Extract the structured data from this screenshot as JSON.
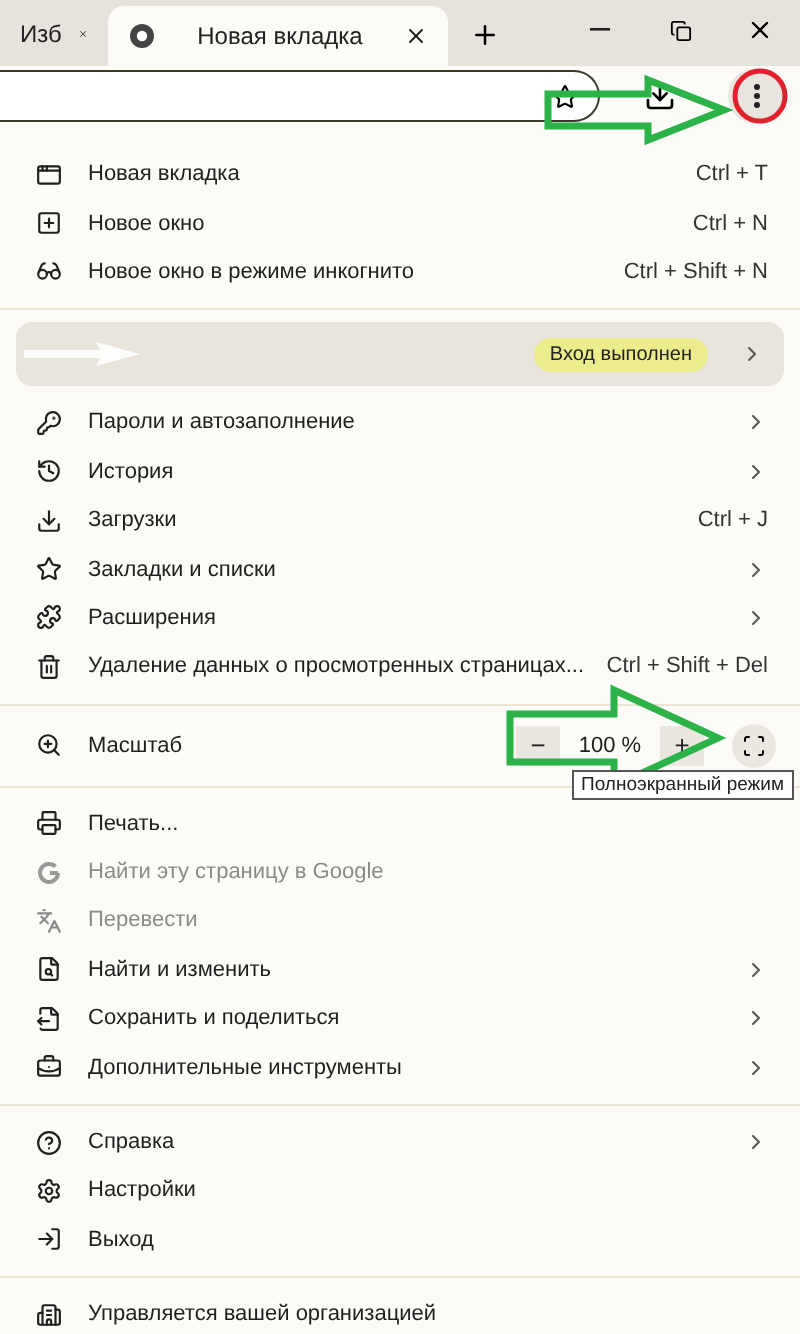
{
  "tabs": [
    {
      "title": "Изб",
      "selected": false
    },
    {
      "title": "Новая вкладка",
      "selected": true
    }
  ],
  "profile": {
    "status": "Вход выполнен"
  },
  "zoom": {
    "label": "Масштаб",
    "value": "100 %",
    "minus": "−",
    "plus": "+",
    "tooltip": "Полноэкранный режим"
  },
  "sections": [
    {
      "items": [
        {
          "label": "Новая вкладка",
          "shortcut": "Ctrl + T",
          "submenu": false,
          "disabled": false
        },
        {
          "label": "Новое окно",
          "shortcut": "Ctrl + N",
          "submenu": false,
          "disabled": false
        },
        {
          "label": "Новое окно в режиме инкогнито",
          "shortcut": "Ctrl + Shift + N",
          "submenu": false,
          "disabled": false
        }
      ]
    },
    {
      "kind": "profile"
    },
    {
      "items": [
        {
          "label": "Пароли и автозаполнение",
          "submenu": true,
          "disabled": false
        },
        {
          "label": "История",
          "submenu": true,
          "disabled": false
        },
        {
          "label": "Загрузки",
          "shortcut": "Ctrl + J",
          "submenu": false,
          "disabled": false
        },
        {
          "label": "Закладки и списки",
          "submenu": true,
          "disabled": false
        },
        {
          "label": "Расширения",
          "submenu": true,
          "disabled": false
        },
        {
          "label": "Удаление данных о просмотренных страницах...",
          "shortcut": "Ctrl + Shift + Del",
          "submenu": false,
          "disabled": false
        }
      ]
    },
    {
      "kind": "zoom"
    },
    {
      "items": [
        {
          "label": "Печать...",
          "submenu": false,
          "disabled": false
        },
        {
          "label": "Найти эту страницу в Google",
          "submenu": false,
          "disabled": true
        },
        {
          "label": "Перевести",
          "submenu": false,
          "disabled": true
        },
        {
          "label": "Найти и изменить",
          "submenu": true,
          "disabled": false
        },
        {
          "label": "Сохранить и поделиться",
          "submenu": true,
          "disabled": false
        },
        {
          "label": "Дополнительные инструменты",
          "submenu": true,
          "disabled": false
        }
      ]
    },
    {
      "items": [
        {
          "label": "Справка",
          "submenu": true,
          "disabled": false
        },
        {
          "label": "Настройки",
          "submenu": false,
          "disabled": false
        },
        {
          "label": "Выход",
          "submenu": false,
          "disabled": false
        }
      ]
    },
    {
      "items": [
        {
          "label": "Управляется вашей организацией",
          "submenu": false,
          "disabled": false
        }
      ]
    }
  ]
}
